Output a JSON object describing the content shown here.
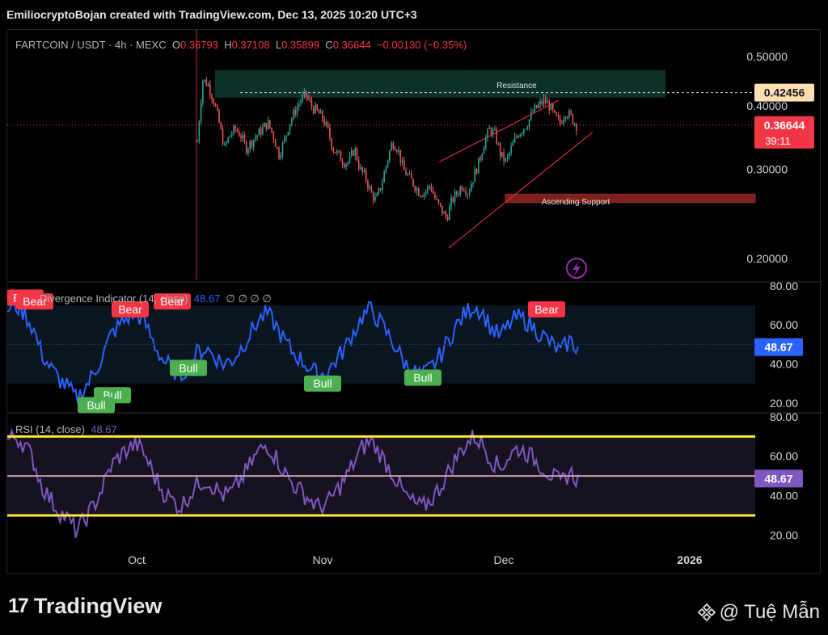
{
  "header": {
    "credit": "EmiliocryptoBojan created with TradingView.com, Dec 13, 2025 10:20 UTC+3"
  },
  "legend_main": {
    "symbol": "FARTCOIN / USDT · 4h · MEXC",
    "o_label": "O",
    "o_value": "0.36793",
    "h_label": "H",
    "h_value": "0.37108",
    "l_label": "L",
    "l_value": "0.35899",
    "c_label": "C",
    "c_value": "0.36644",
    "change": "−0.00130 (−0.35%)"
  },
  "legend_div": {
    "name": "Divergence Indicator (14, close)",
    "value": "48.67",
    "extras": "∅ ∅ ∅ ∅"
  },
  "legend_rsi": {
    "name": "RSI (14, close)",
    "value": "48.67"
  },
  "colors": {
    "up": "#26a69a",
    "down": "#ef5350",
    "resistance_fill": "#0f3a31",
    "support_fill": "#e53935",
    "div_line": "#2962ff",
    "rsi_line": "#7e57c2",
    "band": "#ffeb3b",
    "price_tag": "#f23645",
    "target_tag": "#ffe0b2"
  },
  "footer": {
    "brand": "TradingView",
    "brand_mark": "17",
    "watermark": "@ Tuệ Mẫn"
  },
  "chart_data": [
    {
      "type": "candlestick",
      "title": "FARTCOIN / USDT · 4h · MEXC",
      "y_ticks": [
        "0.50000",
        "0.40000",
        "0.30000",
        "0.20000"
      ],
      "x_ticks": [
        "Oct",
        "Nov",
        "Dec",
        "2026"
      ],
      "ylim": [
        0.18,
        0.56
      ],
      "scale": "log",
      "last_price": "0.36644",
      "countdown": "39:11",
      "target_price": "0.42456",
      "annotations": [
        {
          "text": "Resistance",
          "zone": [
            0.415,
            0.47
          ]
        },
        {
          "text": "Ascending Support",
          "from": 0.21,
          "to": 0.38
        },
        {
          "text": "",
          "zone": [
            0.258,
            0.268
          ]
        }
      ],
      "close_path": [
        0.34,
        0.45,
        0.44,
        0.41,
        0.37,
        0.33,
        0.35,
        0.36,
        0.35,
        0.33,
        0.34,
        0.35,
        0.36,
        0.37,
        0.35,
        0.32,
        0.34,
        0.37,
        0.39,
        0.41,
        0.42,
        0.4,
        0.39,
        0.38,
        0.36,
        0.33,
        0.32,
        0.31,
        0.31,
        0.33,
        0.3,
        0.29,
        0.27,
        0.26,
        0.28,
        0.31,
        0.34,
        0.33,
        0.3,
        0.29,
        0.28,
        0.27,
        0.27,
        0.28,
        0.26,
        0.25,
        0.24,
        0.26,
        0.27,
        0.28,
        0.27,
        0.29,
        0.31,
        0.34,
        0.36,
        0.35,
        0.32,
        0.31,
        0.33,
        0.35,
        0.36,
        0.37,
        0.39,
        0.4,
        0.41,
        0.4,
        0.38,
        0.37,
        0.39,
        0.38,
        0.366
      ]
    },
    {
      "type": "line",
      "title": "Divergence Indicator (14, close)",
      "y_ticks": [
        "80.00",
        "60.00",
        "40.00",
        "20.00"
      ],
      "ylim": [
        15,
        82
      ],
      "last_value": "48.67",
      "labels": [
        {
          "text": "Bear",
          "kind": "bear"
        },
        {
          "text": "Bear",
          "kind": "bear"
        },
        {
          "text": "Bear",
          "kind": "bear"
        },
        {
          "text": "Bear",
          "kind": "bear"
        },
        {
          "text": "Bear",
          "kind": "bear"
        },
        {
          "text": "Bull",
          "kind": "bull"
        },
        {
          "text": "Bull",
          "kind": "bull"
        },
        {
          "text": "Bull",
          "kind": "bull"
        },
        {
          "text": "Bull",
          "kind": "bull"
        },
        {
          "text": "Bull",
          "kind": "bull"
        }
      ],
      "values": [
        68,
        70,
        66,
        58,
        45,
        38,
        32,
        28,
        22,
        28,
        35,
        44,
        55,
        60,
        64,
        66,
        60,
        50,
        42,
        38,
        34,
        40,
        46,
        48,
        44,
        40,
        42,
        48,
        55,
        62,
        66,
        60,
        52,
        46,
        42,
        38,
        34,
        36,
        42,
        48,
        56,
        64,
        68,
        62,
        55,
        48,
        40,
        36,
        34,
        38,
        44,
        52,
        60,
        66,
        70,
        66,
        58,
        54,
        60,
        64,
        62,
        58,
        54,
        50,
        46,
        52,
        48
      ]
    },
    {
      "type": "line",
      "title": "RSI (14, close)",
      "y_ticks": [
        "80.00",
        "60.00",
        "40.00",
        "20.00"
      ],
      "ylim": [
        14,
        82
      ],
      "bands": [
        70,
        30
      ],
      "midline": 50,
      "last_value": "48.67",
      "values": [
        68,
        70,
        66,
        58,
        45,
        38,
        32,
        28,
        22,
        28,
        35,
        44,
        55,
        60,
        64,
        66,
        60,
        50,
        42,
        38,
        34,
        40,
        46,
        48,
        44,
        40,
        42,
        48,
        55,
        62,
        66,
        60,
        52,
        46,
        42,
        38,
        34,
        36,
        42,
        48,
        56,
        64,
        68,
        62,
        55,
        48,
        40,
        36,
        34,
        38,
        44,
        52,
        60,
        66,
        70,
        66,
        58,
        54,
        60,
        64,
        62,
        58,
        54,
        50,
        46,
        52,
        48
      ]
    }
  ]
}
